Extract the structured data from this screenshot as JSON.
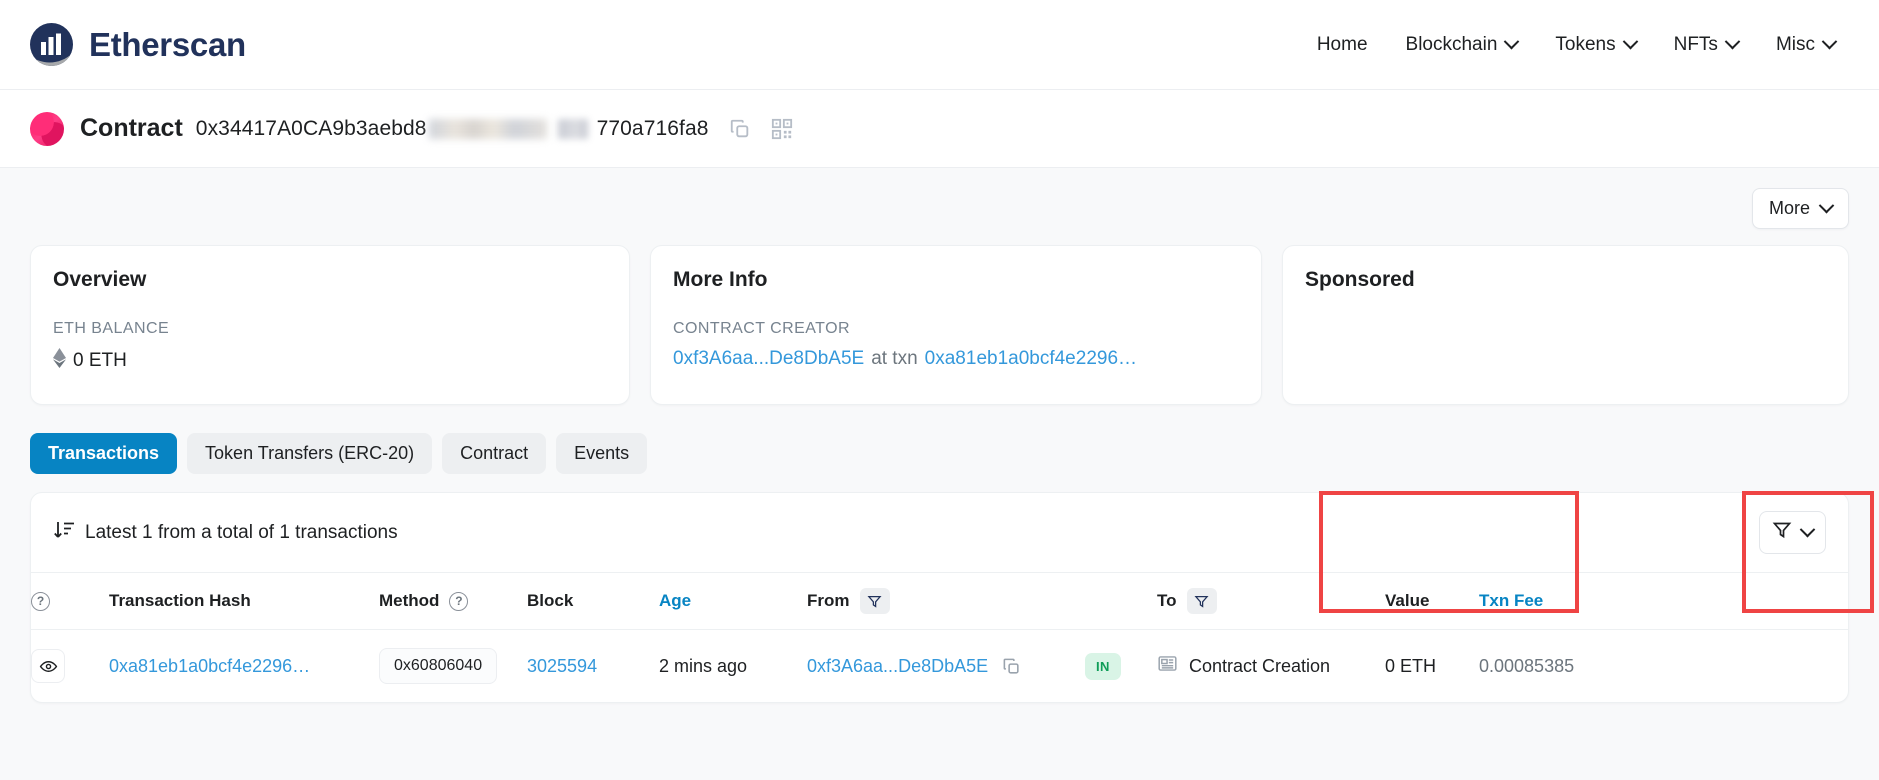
{
  "nav": {
    "brand": "Etherscan",
    "items": [
      {
        "label": "Home",
        "caret": false
      },
      {
        "label": "Blockchain",
        "caret": true
      },
      {
        "label": "Tokens",
        "caret": true
      },
      {
        "label": "NFTs",
        "caret": true
      },
      {
        "label": "Misc",
        "caret": true
      }
    ]
  },
  "address_bar": {
    "title": "Contract",
    "address_prefix": "0x34417A0CA9b3aebd8",
    "address_suffix": "770a716fa8",
    "copy_icon": "copy-icon",
    "qr_icon": "qr-code-icon"
  },
  "toolbar": {
    "more_label": "More"
  },
  "overview": {
    "title": "Overview",
    "balance_label": "ETH BALANCE",
    "balance_value": "0 ETH",
    "eth_icon": "ethereum-diamond-icon"
  },
  "more_info": {
    "title": "More Info",
    "creator_label": "CONTRACT CREATOR",
    "creator_address": "0xf3A6aa...De8DbA5E",
    "creator_joiner": "at txn",
    "creator_txn": "0xa81eb1a0bcf4e2296…"
  },
  "sponsored": {
    "title": "Sponsored"
  },
  "tabs": [
    {
      "label": "Transactions",
      "active": true
    },
    {
      "label": "Token Transfers (ERC-20)",
      "active": false
    },
    {
      "label": "Contract",
      "active": false
    },
    {
      "label": "Events",
      "active": false
    }
  ],
  "table": {
    "summary": "Latest 1 from a total of 1 transactions",
    "sort_icon": "sort-descending-icon",
    "filter_button_icon": "funnel-icon",
    "headers": {
      "info": "?",
      "txn_hash": "Transaction Hash",
      "method": "Method",
      "block": "Block",
      "age": "Age",
      "from": "From",
      "to": "To",
      "value": "Value",
      "txn_fee": "Txn Fee"
    },
    "rows": [
      {
        "eye_icon": "eye-icon",
        "txn_hash": "0xa81eb1a0bcf4e2296…",
        "method": "0x60806040",
        "block": "3025594",
        "age": "2 mins ago",
        "from": "0xf3A6aa...De8DbA5E",
        "from_copy_icon": "copy-icon",
        "direction": "IN",
        "to_icon": "contract-document-icon",
        "to": "Contract Creation",
        "value": "0 ETH",
        "txn_fee": "0.00085385"
      }
    ]
  },
  "colors": {
    "accent_blue": "#0784c3",
    "link_blue": "#3498db",
    "brand_navy": "#21325b",
    "annotation_red": "#ef4444",
    "in_badge_green": "#0f9d58"
  }
}
